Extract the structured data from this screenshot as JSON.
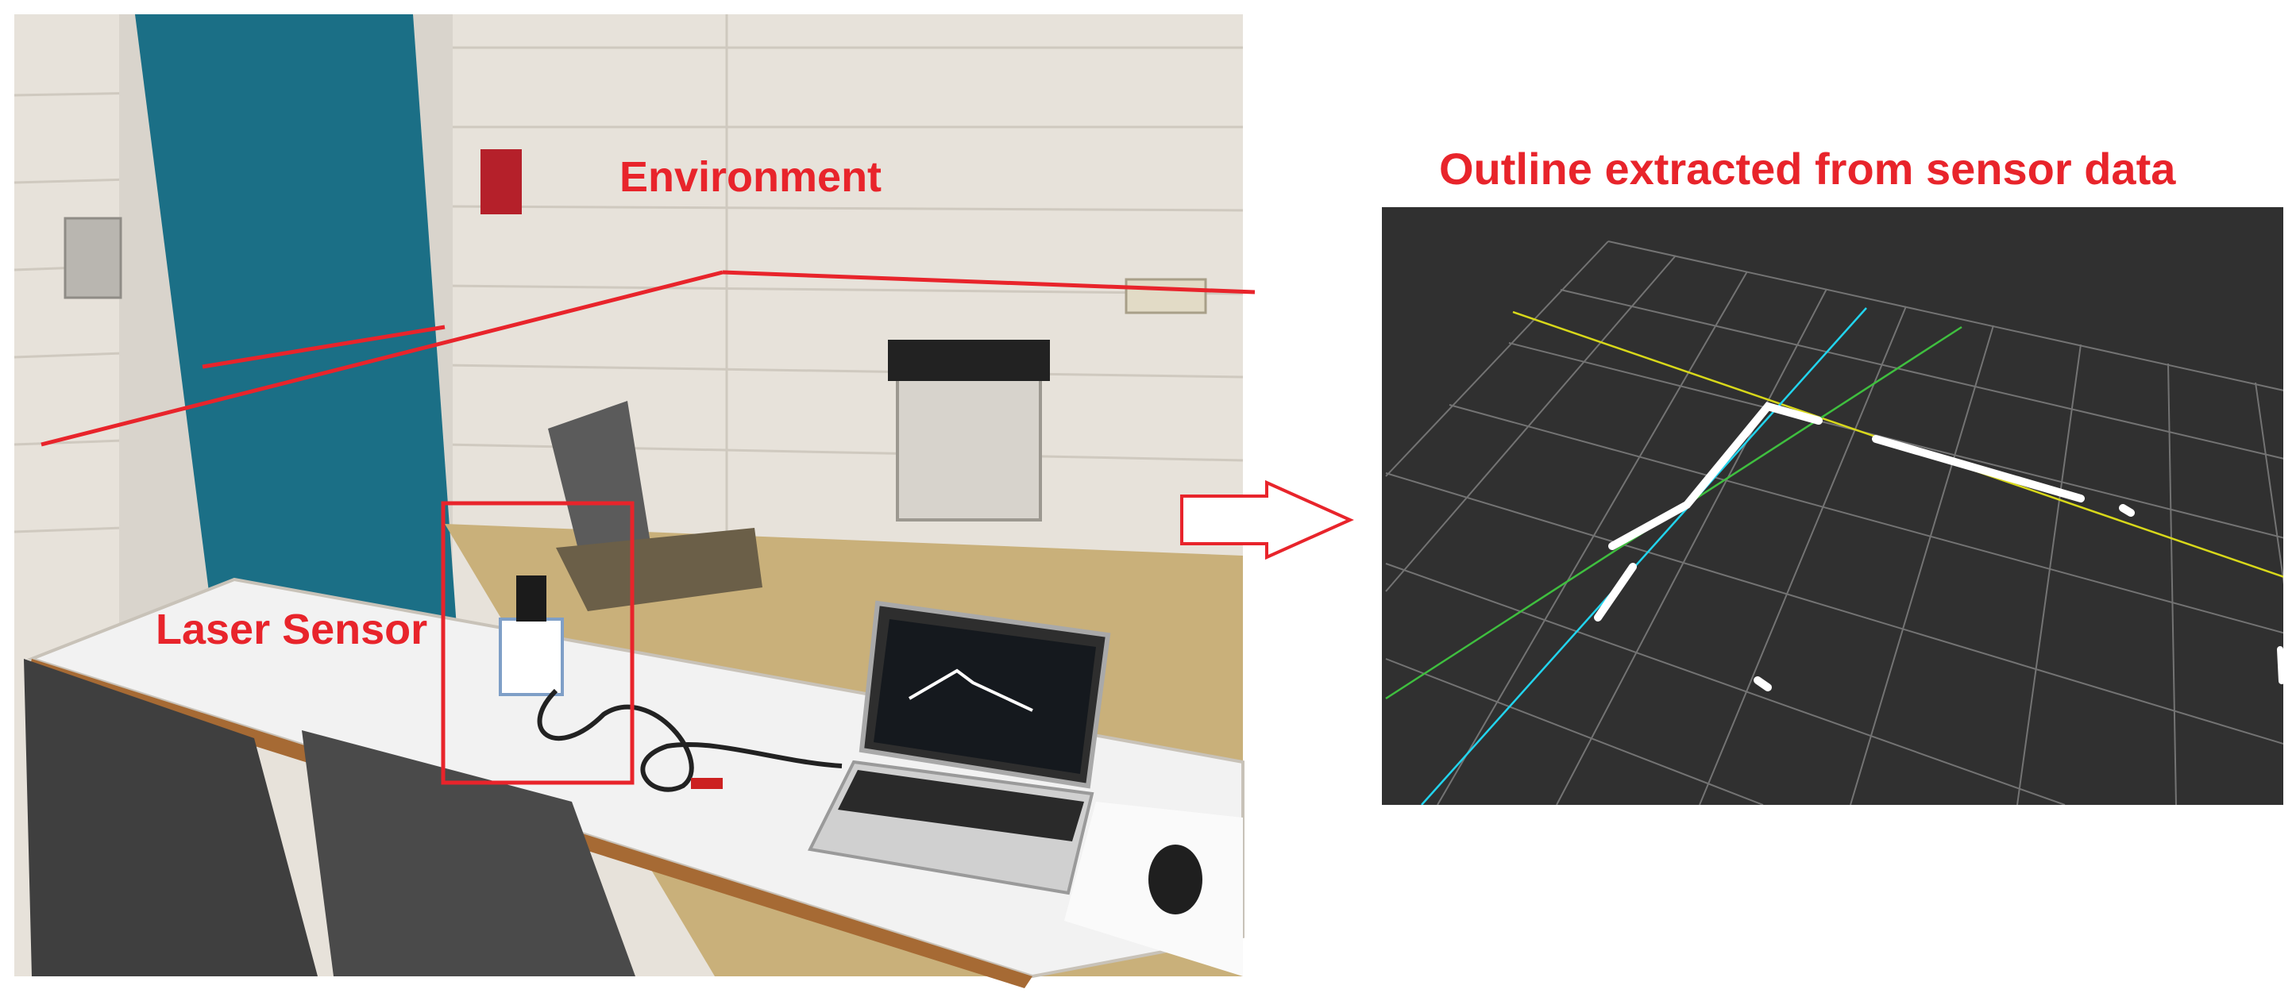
{
  "labels": {
    "environment": "Environment",
    "laser_sensor": "Laser Sensor",
    "outline": "Outline extracted from sensor data"
  },
  "colors": {
    "annotation": "#e8242b",
    "viz_background": "#303030",
    "grid": "#8a8a8a",
    "axis_yellow": "#d8d81a",
    "axis_cyan": "#22d4ee",
    "axis_green": "#3fbf3f",
    "scan_points": "#ffffff",
    "wall": "#e9e4dc",
    "door": "#1b6f86",
    "table": "#f2f2f2",
    "floor": "#c9b07a",
    "chair": "#4a4a4a"
  }
}
